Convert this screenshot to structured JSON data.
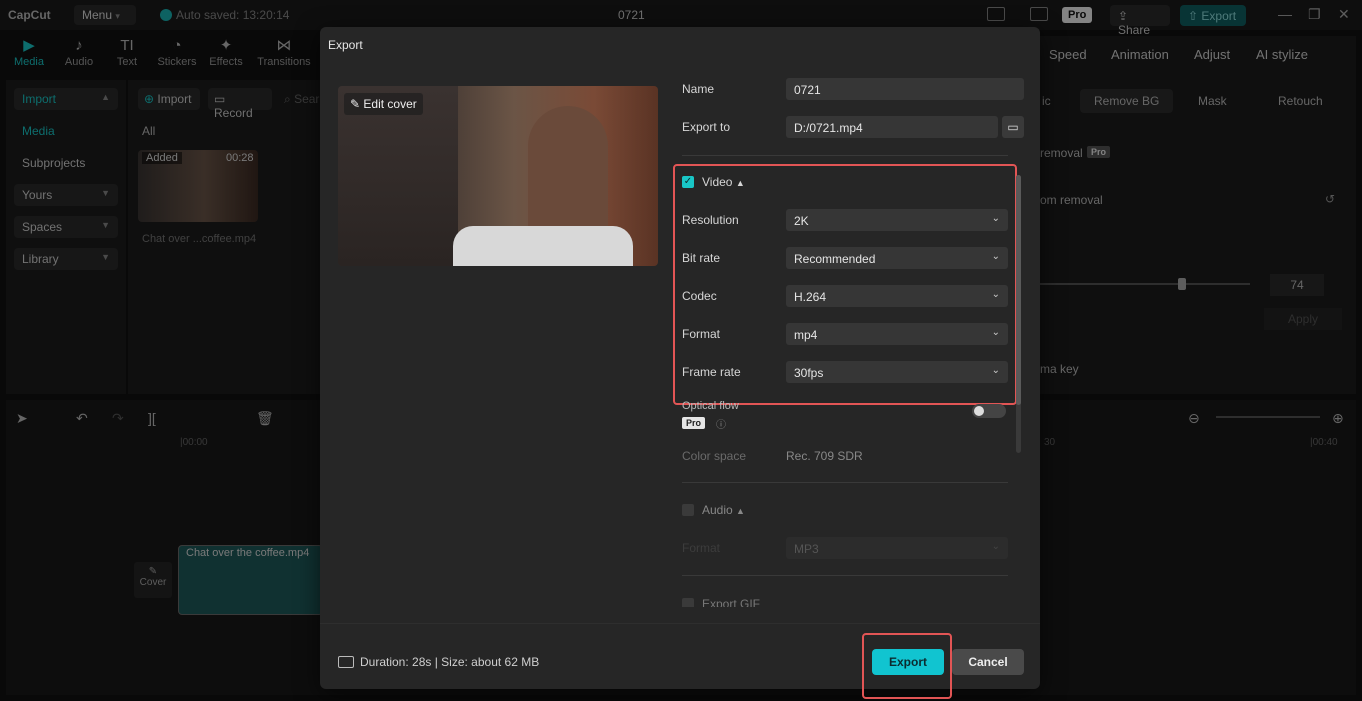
{
  "titlebar": {
    "logo": "CapCut",
    "menu": "Menu",
    "autosave": "Auto saved: 13:20:14",
    "title": "0721",
    "pro": "Pro",
    "share": "Share",
    "export": "Export"
  },
  "toolbar": {
    "items": [
      {
        "label": "Media",
        "icon": "▶"
      },
      {
        "label": "Audio",
        "icon": "♪"
      },
      {
        "label": "Text",
        "icon": "TI"
      },
      {
        "label": "Stickers",
        "icon": "◔"
      },
      {
        "label": "Effects",
        "icon": "✦"
      },
      {
        "label": "Transitions",
        "icon": "⋈"
      }
    ]
  },
  "sidebar": {
    "items": [
      {
        "label": "Import"
      },
      {
        "label": "Media"
      },
      {
        "label": "Subprojects"
      },
      {
        "label": "Yours"
      },
      {
        "label": "Spaces"
      },
      {
        "label": "Library"
      }
    ]
  },
  "media": {
    "import": "Import",
    "record": "Record",
    "search": "Sear",
    "filter": "All",
    "thumb_badge": "Added",
    "thumb_duration": "00:28",
    "thumb_name": "Chat over ...coffee.mp4"
  },
  "rightpanel": {
    "tabs": [
      "Speed",
      "Animation",
      "Adjust",
      "AI stylize"
    ],
    "subtabs": [
      "ic",
      "Remove BG",
      "Mask",
      "Retouch"
    ],
    "removal": "removal",
    "custom_removal": "om removal",
    "pro": "Pro",
    "value": "74",
    "apply": "Apply",
    "chroma": "ma key"
  },
  "timeline": {
    "ticks": [
      "|00:00",
      "30",
      "|00:40"
    ],
    "cover": "Cover",
    "clip_label": "Chat over the coffee.mp4"
  },
  "dialog": {
    "title": "Export",
    "edit_cover": "Edit cover",
    "name_label": "Name",
    "name_value": "0721",
    "export_to_label": "Export to",
    "export_to_value": "D:/0721.mp4",
    "video_section": "Video",
    "resolution_label": "Resolution",
    "resolution_value": "2K",
    "bitrate_label": "Bit rate",
    "bitrate_value": "Recommended",
    "codec_label": "Codec",
    "codec_value": "H.264",
    "format_label": "Format",
    "format_value": "mp4",
    "framerate_label": "Frame rate",
    "framerate_value": "30fps",
    "optical_flow_label": "Optical flow",
    "pro": "Pro",
    "colorspace_label": "Color space",
    "colorspace_value": "Rec. 709 SDR",
    "audio_section": "Audio",
    "audio_format_label": "Format",
    "audio_format_value": "MP3",
    "gif_section": "Export GIF",
    "footer": "Duration: 28s | Size: about 62 MB",
    "export_button": "Export",
    "cancel_button": "Cancel"
  }
}
